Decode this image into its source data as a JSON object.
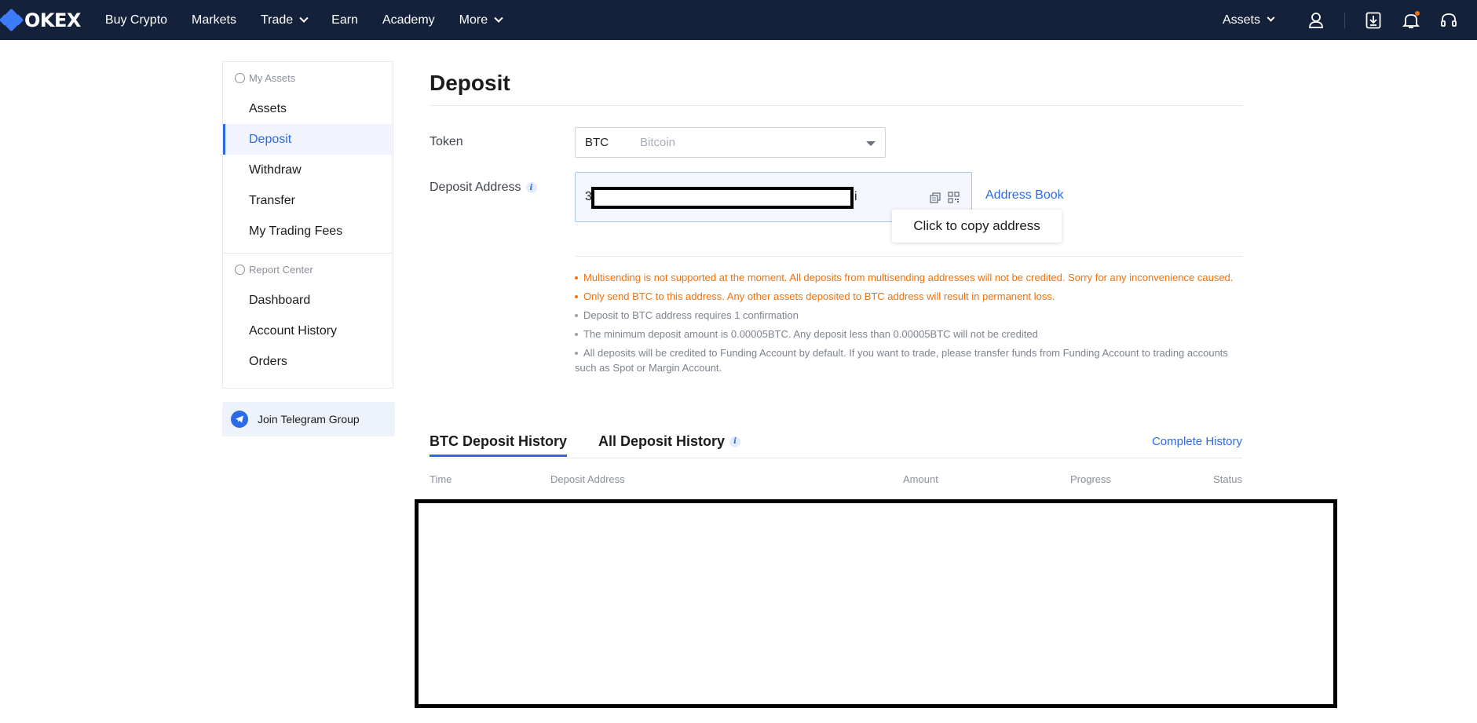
{
  "nav": {
    "logo": "OKEX",
    "items": [
      {
        "label": "Buy Crypto",
        "dropdown": false
      },
      {
        "label": "Markets",
        "dropdown": false
      },
      {
        "label": "Trade",
        "dropdown": true
      },
      {
        "label": "Earn",
        "dropdown": false
      },
      {
        "label": "Academy",
        "dropdown": false
      },
      {
        "label": "More",
        "dropdown": true
      }
    ],
    "assets_label": "Assets",
    "icons": [
      "user-icon",
      "download-icon",
      "bell-icon",
      "headset-icon"
    ],
    "colors": {
      "background": "#14213a",
      "brand": "#3d7bf7"
    }
  },
  "sidebar": {
    "group1_title": "My Assets",
    "group1_items": [
      "Assets",
      "Deposit",
      "Withdraw",
      "Transfer",
      "My Trading Fees"
    ],
    "active_item": "Deposit",
    "group2_title": "Report Center",
    "group2_items": [
      "Dashboard",
      "Account History",
      "Orders"
    ],
    "telegram_label": "Join Telegram Group"
  },
  "main": {
    "title": "Deposit",
    "token_label": "Token",
    "token_symbol": "BTC",
    "token_name": "Bitcoin",
    "address_label": "Deposit Address",
    "address_prefix": "3",
    "address_suffix": "i",
    "address_book": "Address Book",
    "tooltip": "Click to copy address",
    "notes": [
      {
        "type": "warn",
        "text": "Multisending is not supported at the moment. All deposits from multisending addresses will not be credited. Sorry for any inconvenience caused."
      },
      {
        "type": "warn",
        "text": "Only send BTC to this address. Any other assets deposited to BTC address will result in permanent loss."
      },
      {
        "type": "info",
        "text": "Deposit to BTC address requires 1 confirmation"
      },
      {
        "type": "info",
        "text": "The minimum deposit amount is 0.00005BTC. Any deposit less than 0.00005BTC will not be credited"
      },
      {
        "type": "info",
        "text": "All deposits will be credited to Funding Account by default. If you want to trade, please transfer funds from Funding Account to trading accounts such as Spot or Margin Account."
      }
    ],
    "tabs": [
      "BTC Deposit History",
      "All Deposit History"
    ],
    "complete_history": "Complete History",
    "columns": [
      "Time",
      "Deposit Address",
      "Amount",
      "Progress",
      "Status"
    ],
    "colors": {
      "accent": "#2c6ae6",
      "warning": "#f0710f"
    }
  }
}
